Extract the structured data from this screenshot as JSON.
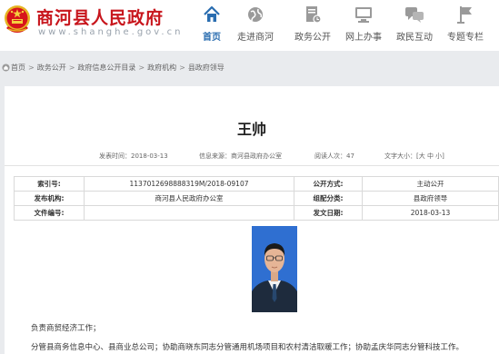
{
  "header": {
    "site_title": "商河县人民政府",
    "site_domain": "www.shanghe.gov.cn",
    "nav": [
      {
        "label": "首页",
        "icon": "home-icon",
        "active": true
      },
      {
        "label": "走进商河",
        "icon": "globe-icon"
      },
      {
        "label": "政务公开",
        "icon": "document-icon"
      },
      {
        "label": "网上办事",
        "icon": "monitor-icon"
      },
      {
        "label": "政民互动",
        "icon": "chat-icon"
      },
      {
        "label": "专题专栏",
        "icon": "flag-icon"
      }
    ]
  },
  "breadcrumb": [
    "首页",
    "政务公开",
    "政府信息公开目录",
    "政府机构",
    "县政府领导"
  ],
  "article": {
    "title": "王帅",
    "publish_time": "发表时间：2018-03-13",
    "source": "信息来源：商河县政府办公室",
    "views": "阅读人次：47",
    "font_size_label": "文字大小：",
    "font_size_options": "[大 中 小]"
  },
  "info_table": {
    "index_label": "索引号:",
    "index_value": "1137012698888319M/2018-09107",
    "disclosure_label": "公开方式:",
    "disclosure_value": "主动公开",
    "issuer_label": "发布机构:",
    "issuer_value": "商河县人民政府办公室",
    "category_label": "组配分类:",
    "category_value": "县政府领导",
    "doc_number_label": "文件编号:",
    "doc_number_value": "",
    "date_label": "发文日期:",
    "date_value": "2018-03-13"
  },
  "content": {
    "paragraph_1": "负责商贸经济工作；",
    "paragraph_2": "分管县商务信息中心、县商业总公司；协助商晓东同志分管通用机场项目和农村清洁取暖工作；协助孟庆华同志分管科技工作。"
  },
  "colors": {
    "brand_red": "#c8161d",
    "nav_active": "#2a6db0",
    "page_bg": "#e9ebee"
  }
}
